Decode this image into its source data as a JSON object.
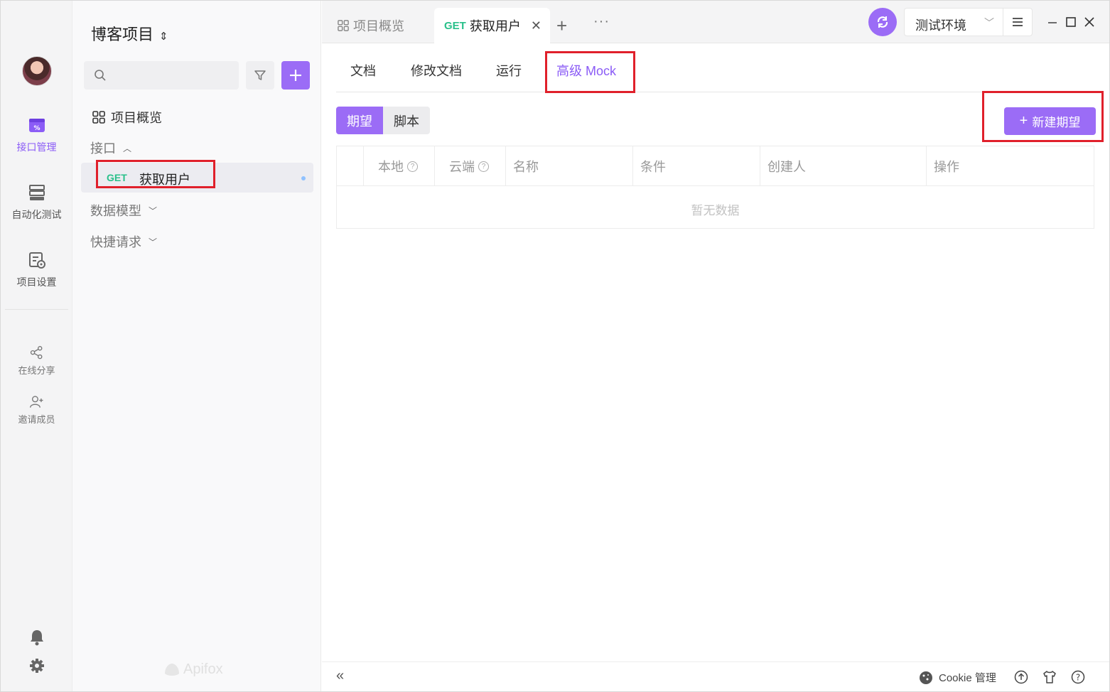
{
  "rail": {
    "items": [
      {
        "label": "接口管理",
        "icon": "api-management-icon",
        "active": true
      },
      {
        "label": "自动化测试",
        "icon": "automation-test-icon"
      },
      {
        "label": "项目设置",
        "icon": "project-settings-icon"
      }
    ],
    "share_label": "在线分享",
    "invite_label": "邀请成员"
  },
  "sidebar": {
    "project_title": "博客项目",
    "search_placeholder": "",
    "overview_label": "项目概览",
    "group_api_label": "接口",
    "selected": {
      "method": "GET",
      "name": "获取用户"
    },
    "group_models_label": "数据模型",
    "group_quick_label": "快捷请求",
    "brand": "Apifox"
  },
  "tabs": {
    "overview": "项目概览",
    "active_method": "GET",
    "active_name": "获取用户",
    "close": "✕",
    "plus": "+",
    "more": "···"
  },
  "env": {
    "value": "测试环境"
  },
  "subtabs": [
    "文档",
    "修改文档",
    "运行",
    "高级 Mock"
  ],
  "segment": {
    "on": "期望",
    "off": "脚本"
  },
  "new_button": "新建期望",
  "table": {
    "columns": [
      "本地",
      "云端",
      "名称",
      "条件",
      "创建人",
      "操作"
    ],
    "empty_text": "暂无数据"
  },
  "bottom": {
    "cookie_label": "Cookie 管理"
  },
  "colors": {
    "accent": "#9b6cf6",
    "get": "#29c08a",
    "highlight": "#e0202b"
  }
}
